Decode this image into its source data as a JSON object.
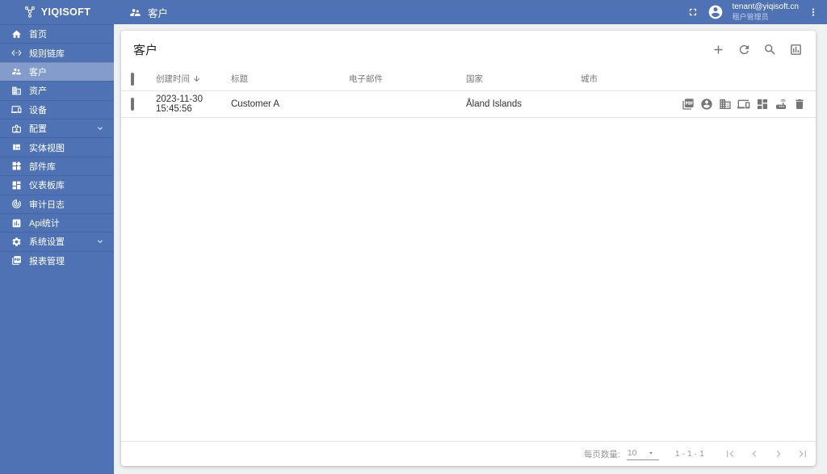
{
  "brand": {
    "name": "YIQISOFT"
  },
  "topbar": {
    "title": "客户",
    "user": {
      "email": "tenant@yiqisoft.cn",
      "role": "租户管理员"
    }
  },
  "sidebar": {
    "items": [
      {
        "label": "首页",
        "icon": "home-icon"
      },
      {
        "label": "规则链库",
        "icon": "rule-chain-icon"
      },
      {
        "label": "客户",
        "icon": "customers-icon",
        "active": true
      },
      {
        "label": "资产",
        "icon": "assets-icon"
      },
      {
        "label": "设备",
        "icon": "devices-icon"
      },
      {
        "label": "配置",
        "icon": "profiles-icon",
        "expandable": true
      },
      {
        "label": "实体视图",
        "icon": "entity-views-icon"
      },
      {
        "label": "部件库",
        "icon": "widgets-icon"
      },
      {
        "label": "仪表板库",
        "icon": "dashboards-icon"
      },
      {
        "label": "审计日志",
        "icon": "audit-logs-icon"
      },
      {
        "label": "Api统计",
        "icon": "api-usage-icon"
      },
      {
        "label": "系统设置",
        "icon": "settings-icon",
        "expandable": true
      },
      {
        "label": "报表管理",
        "icon": "reports-icon"
      }
    ]
  },
  "card": {
    "title": "客户",
    "toolbar": {
      "icons": [
        "add-icon",
        "refresh-icon",
        "search-icon",
        "columns-icon"
      ]
    },
    "table": {
      "columns": [
        "创建时间",
        "标题",
        "电子邮件",
        "国家",
        "城市"
      ],
      "sorted_column": "创建时间",
      "sort_direction": "desc",
      "rows": [
        {
          "created_time": "2023-11-30 15:45:56",
          "title": "Customer A",
          "email": "",
          "country": "Åland Islands",
          "city": "",
          "actions": [
            "customer-report",
            "manage-customer-users",
            "manage-customer-assets",
            "manage-customer-devices",
            "manage-customer-dashboards",
            "manage-customer-edges",
            "delete-customer"
          ]
        }
      ]
    },
    "pagination": {
      "page_size_label": "每页数量:",
      "page_size": "10",
      "range": "1 - 1 · 1"
    }
  },
  "colors": {
    "primary": "#4f72b5",
    "sidebar_active": "#7b96c8",
    "icon_gray": "#757575"
  }
}
